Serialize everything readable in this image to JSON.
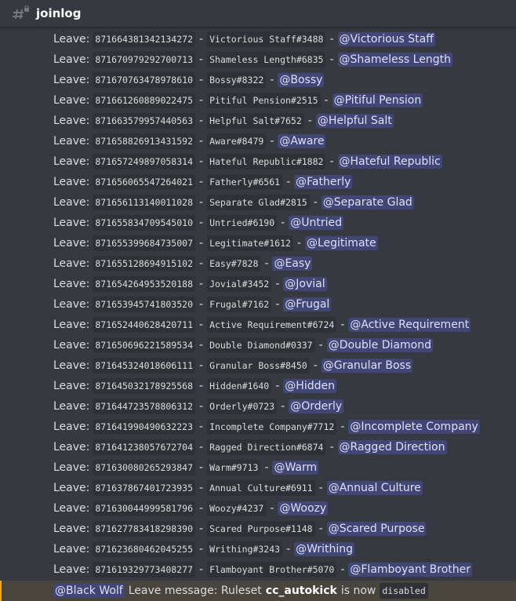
{
  "channel": {
    "name": "joinlog",
    "icon": "hash-lock-icon"
  },
  "leave_label": "Leave:",
  "separator": "-",
  "entries": [
    {
      "id": "871664381342134272",
      "tag": "Victorious Staff#3488",
      "mention": "@Victorious Staff"
    },
    {
      "id": "871670979292700713",
      "tag": "Shameless Length#6835",
      "mention": "@Shameless Length"
    },
    {
      "id": "871670763478978610",
      "tag": "Bossy#8322",
      "mention": "@Bossy"
    },
    {
      "id": "871661260889022475",
      "tag": "Pitiful Pension#2515",
      "mention": "@Pitiful Pension"
    },
    {
      "id": "871663579957440563",
      "tag": "Helpful Salt#7652",
      "mention": "@Helpful Salt"
    },
    {
      "id": "871658826913431592",
      "tag": "Aware#8479",
      "mention": "@Aware"
    },
    {
      "id": "871657249897058314",
      "tag": "Hateful Republic#1882",
      "mention": "@Hateful Republic"
    },
    {
      "id": "871656065547264021",
      "tag": "Fatherly#6561",
      "mention": "@Fatherly"
    },
    {
      "id": "871656113140011028",
      "tag": "Separate Glad#2815",
      "mention": "@Separate Glad"
    },
    {
      "id": "871655834709545010",
      "tag": "Untried#6190",
      "mention": "@Untried"
    },
    {
      "id": "871655399684735007",
      "tag": "Legitimate#1612",
      "mention": "@Legitimate"
    },
    {
      "id": "871655128694915102",
      "tag": "Easy#7828",
      "mention": "@Easy"
    },
    {
      "id": "871654264953520188",
      "tag": "Jovial#3452",
      "mention": "@Jovial"
    },
    {
      "id": "871653945741803520",
      "tag": "Frugal#7162",
      "mention": "@Frugal"
    },
    {
      "id": "871652440628420711",
      "tag": "Active Requirement#6724",
      "mention": "@Active Requirement"
    },
    {
      "id": "871650696221589534",
      "tag": "Double Diamond#0337",
      "mention": "@Double Diamond"
    },
    {
      "id": "871645324018606111",
      "tag": "Granular Boss#8450",
      "mention": "@Granular Boss"
    },
    {
      "id": "871645032178925568",
      "tag": "Hidden#1640",
      "mention": "@Hidden"
    },
    {
      "id": "871644723578806312",
      "tag": "Orderly#0723",
      "mention": "@Orderly"
    },
    {
      "id": "871641990490632223",
      "tag": "Incomplete Company#7712",
      "mention": "@Incomplete Company"
    },
    {
      "id": "871641238057672704",
      "tag": "Ragged Direction#6874",
      "mention": "@Ragged Direction"
    },
    {
      "id": "871630080265293847",
      "tag": "Warm#9713",
      "mention": "@Warm"
    },
    {
      "id": "871637867401723935",
      "tag": "Annual Culture#6911",
      "mention": "@Annual Culture"
    },
    {
      "id": "871630044999581796",
      "tag": "Woozy#4237",
      "mention": "@Woozy"
    },
    {
      "id": "871627783418298390",
      "tag": "Scared Purpose#1148",
      "mention": "@Scared Purpose"
    },
    {
      "id": "871623680462045255",
      "tag": "Writhing#3243",
      "mention": "@Writhing"
    },
    {
      "id": "871619329773408277",
      "tag": "Flamboyant Brother#5070",
      "mention": "@Flamboyant Brother"
    }
  ],
  "status_message": {
    "mention": "@Black Wolf",
    "text": "Leave message: Ruleset",
    "ruleset": "cc_autokick",
    "is_now": "is now",
    "state": "disabled"
  }
}
